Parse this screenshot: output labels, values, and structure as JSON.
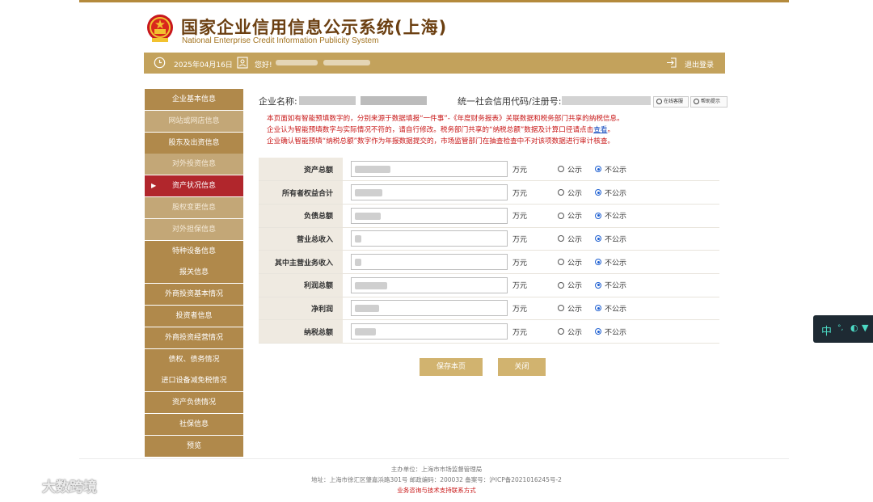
{
  "header": {
    "title": "国家企业信用信息公示系统(上海)",
    "subtitle": "National Enterprise Credit Information Publicity System"
  },
  "infobar": {
    "date": "2025年04月16日",
    "greeting": "您好!",
    "logout": "退出登录"
  },
  "sidebar": {
    "items": [
      {
        "label": "企业基本信息",
        "style": "normal"
      },
      {
        "label": "网站或网店信息",
        "style": "alt"
      },
      {
        "label": "股东及出资信息",
        "style": "normal"
      },
      {
        "label": "对外投资信息",
        "style": "alt"
      },
      {
        "label": "资产状况信息",
        "style": "active"
      },
      {
        "label": "股权变更信息",
        "style": "alt"
      },
      {
        "label": "对外担保信息",
        "style": "alt"
      },
      {
        "label": "特种设备信息",
        "style": "normal"
      },
      {
        "label": "报关信息",
        "style": "normal"
      },
      {
        "label": "外商投资基本情况",
        "style": "normal"
      },
      {
        "label": "投资者信息",
        "style": "normal"
      },
      {
        "label": "外商投资经营情况",
        "style": "normal"
      },
      {
        "label": "债权、债务情况",
        "style": "normal"
      },
      {
        "label": "进口设备减免税情况",
        "style": "normal"
      },
      {
        "label": "资产负债情况",
        "style": "normal"
      },
      {
        "label": "社保信息",
        "style": "normal"
      },
      {
        "label": "预览",
        "style": "normal"
      }
    ]
  },
  "main": {
    "company_label": "企业名称:",
    "code_label": "统一社会信用代码/注册号:",
    "btn_online": "在线客服",
    "btn_help": "帮助提示",
    "notice": {
      "line1": "本页面如有智能预填数字的，分别来源于数据填报“一件事”-《年度财务报表》关联数据和税务部门共享的纳税信息。",
      "line2_pre": "企业认为智能预填数字与实际情况不符的，请自行修改。税务部门共享的“纳税总额”数据及计算口径请点击",
      "line2_link": "查看",
      "line2_post": "。",
      "line3": "企业确认智能预填“纳税总额”数字作为年报数据提交的，市场监管部门在抽查检查中不对该项数据进行审计核查。"
    },
    "unit": "万元",
    "option_public": "公示",
    "option_private": "不公示",
    "rows": [
      {
        "label": "资产总额",
        "selected": "不公示"
      },
      {
        "label": "所有者权益合计",
        "selected": "不公示"
      },
      {
        "label": "负债总额",
        "selected": "不公示"
      },
      {
        "label": "营业总收入",
        "selected": "不公示"
      },
      {
        "label": "其中主营业务收入",
        "selected": "不公示"
      },
      {
        "label": "利润总额",
        "selected": "不公示"
      },
      {
        "label": "净利润",
        "selected": "不公示"
      },
      {
        "label": "纳税总额",
        "selected": "不公示"
      }
    ],
    "save_label": "保存本页",
    "close_label": "关闭"
  },
  "footer": {
    "line1": "主办单位：上海市市场监督管理局",
    "line2": "地址：上海市徐汇区肇嘉浜路301号 邮政编码：200032 备案号：沪ICP备2021016245号-2",
    "line3": "业务咨询与技术支持联系方式"
  },
  "float_tool": {
    "label": "中"
  },
  "watermark": "大数跨境"
}
